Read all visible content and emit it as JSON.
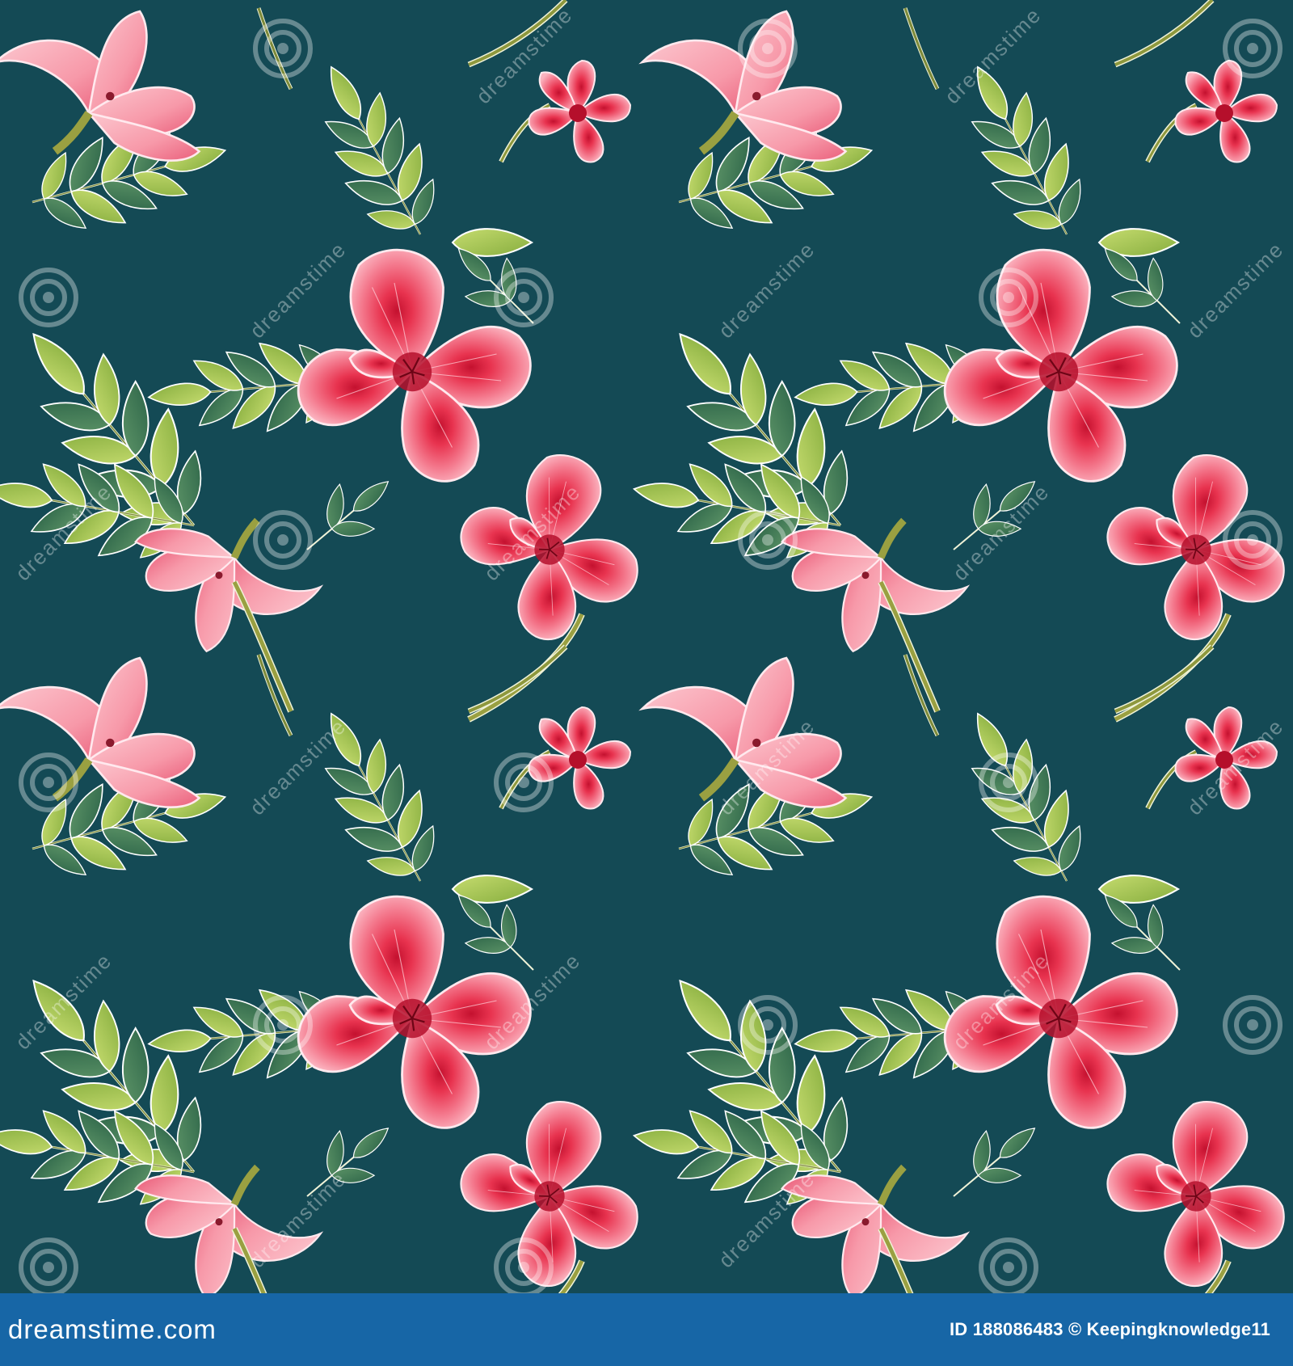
{
  "image": {
    "description_kind": "seamless floral pattern",
    "colors": {
      "background": "#144a55",
      "footer_bar": "#1766a6",
      "petal_light": "#f9b7c2",
      "petal_mid": "#f36d86",
      "petal_center": "#d8243f",
      "leaf_light": "#a9c94f",
      "leaf_dark": "#3e7b56",
      "stem": "#7d8a3a",
      "outline": "#ffffff"
    }
  },
  "watermark": {
    "text": "dreamstime"
  },
  "footer": {
    "brand_left": "dreamstime",
    "brand_dot": ".",
    "brand_right": "com",
    "credit": "ID 188086483 © Keepingknowledge11"
  }
}
